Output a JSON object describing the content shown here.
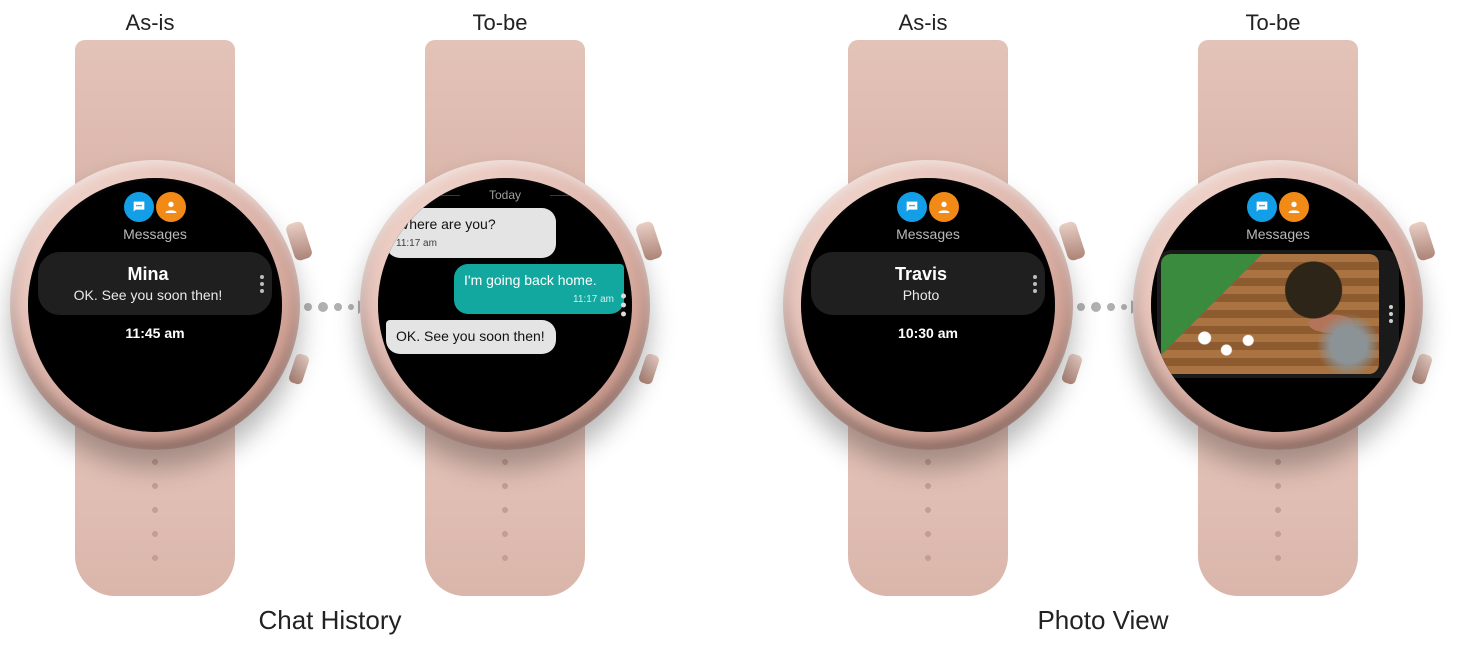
{
  "labels": {
    "as_is": "As-is",
    "to_be": "To-be",
    "chat_history": "Chat History",
    "photo_view": "Photo View"
  },
  "app": {
    "name": "Messages",
    "icons": {
      "chat": "chat-icon",
      "user": "user-icon"
    }
  },
  "colors": {
    "chat_icon_bg": "#139ee8",
    "user_icon_bg": "#f28a17",
    "bubble_out_bg": "#13a89f",
    "bubble_in_bg": "#e4e4e4",
    "strap": "#e0bdb2"
  },
  "chat_history": {
    "as_is": {
      "sender": "Mina",
      "preview": "OK. See you soon then!",
      "time": "11:45 am"
    },
    "to_be": {
      "day": "Today",
      "messages": [
        {
          "dir": "in",
          "text": "Where are you?",
          "time": "11:17 am"
        },
        {
          "dir": "out",
          "text": "I'm going back home.",
          "time": "11:17 am"
        },
        {
          "dir": "in",
          "text": "OK. See you soon then!",
          "time": ""
        }
      ]
    }
  },
  "photo_view": {
    "as_is": {
      "sender": "Travis",
      "preview": "Photo",
      "time": "10:30 am"
    },
    "to_be": {
      "image_desc": "gardening scene with flowers, pots and watering can on wooden deck"
    }
  }
}
